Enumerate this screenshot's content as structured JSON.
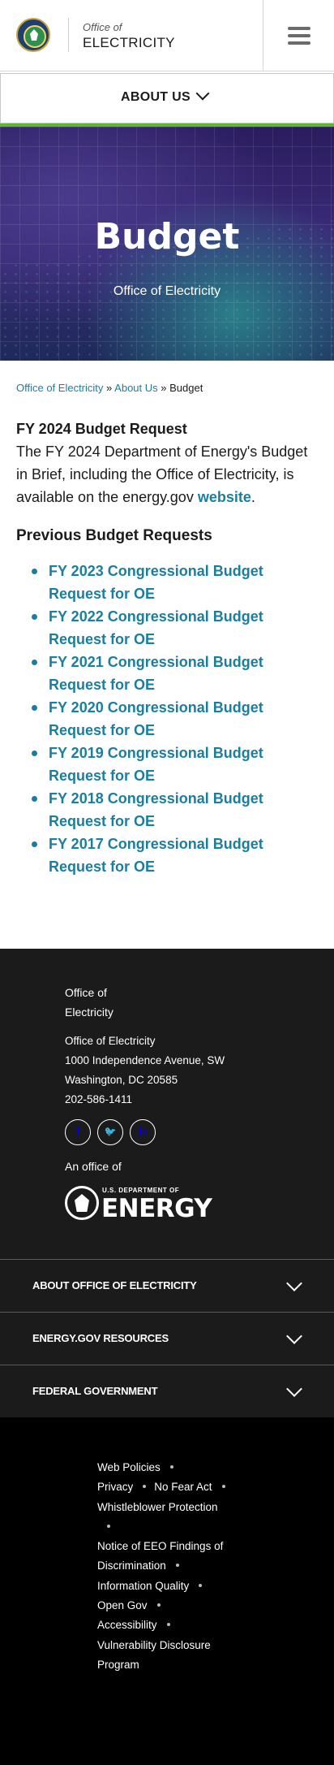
{
  "header": {
    "brand_small": "Office of",
    "brand_big": "ELECTRICITY",
    "menu_icon": "hamburger-icon"
  },
  "subnav": {
    "label": "ABOUT US",
    "icon": "chevron-down-icon"
  },
  "hero": {
    "title": "Budget",
    "subtitle": "Office of Electricity"
  },
  "breadcrumb": {
    "item1": "Office of Electricity",
    "sep1": "»",
    "item2": "About Us",
    "sep2": "»",
    "current": "Budget"
  },
  "content": {
    "heading": "FY 2024 Budget Request",
    "paragraph_prefix": "The FY 2024 Department of Energy's Budget in Brief, including the Office of Electricity, is available on the energy.gov ",
    "paragraph_link": "website",
    "paragraph_suffix": ".",
    "prev_heading": "Previous Budget Requests",
    "links": [
      "FY 2023 Congressional Budget Request for OE",
      "FY 2022 Congressional Budget Request for OE",
      "FY 2021 Congressional Budget Request for OE",
      "FY 2020 Congressional Budget Request for OE",
      "FY 2019 Congressional Budget Request for OE",
      "FY 2018 Congressional Budget Request for OE",
      "FY 2017 Congressional Budget Request for OE"
    ]
  },
  "footer": {
    "name": "Office of Electricity",
    "address": [
      "Office of Electricity",
      "1000 Independence Avenue, SW",
      "Washington, DC 20585",
      "202-586-1411"
    ],
    "social": {
      "facebook": "f",
      "twitter": "🐦",
      "linkedin": "in"
    },
    "an_office_of": "An office of",
    "doe_small": "U.S. DEPARTMENT OF",
    "doe_big": "ENERGY",
    "accordions": [
      "ABOUT OFFICE OF ELECTRICITY",
      "ENERGY.GOV RESOURCES",
      "FEDERAL GOVERNMENT"
    ],
    "legal": {
      "web_policies": "Web Policies",
      "privacy": "Privacy",
      "no_fear_act": "No Fear Act",
      "whistleblower": "Whistleblower Protection",
      "eeo": "Notice of EEO Findings of Discrimination",
      "info_quality": "Information Quality",
      "open_gov": "Open Gov",
      "accessibility": "Accessibility",
      "vdp": "Vulnerability Disclosure Program"
    }
  },
  "colors": {
    "link": "#1a7f9e",
    "accent_green": "#5fb72f",
    "footer_bg": "#1b1b1b"
  }
}
